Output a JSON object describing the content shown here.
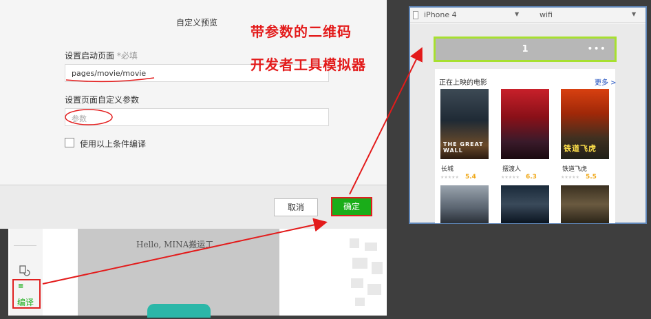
{
  "dialog": {
    "title": "自定义预览",
    "start_page_label": "设置启动页面",
    "start_page_required": "*必填",
    "start_page_value": "pages/movie/movie",
    "params_label": "设置页面自定义参数",
    "params_placeholder": "参数",
    "compile_checkbox_label": "使用以上条件编译",
    "cancel_label": "取消",
    "confirm_label": "确定"
  },
  "annotations": {
    "line1": "带参数的二维码",
    "line2": "开发者工具模拟器"
  },
  "ide": {
    "compile_label": "编译",
    "compile_icon": "≡",
    "hello_text": "Hello, MINA搬运工"
  },
  "simulator": {
    "device": "iPhone 4",
    "network": "wifi",
    "nav_title": "1",
    "nav_menu": "•••",
    "section_title": "正在上映的电影",
    "more_label": "更多 >",
    "movies": [
      {
        "title": "长城",
        "score": "5.4",
        "caption": "THE GREAT WALL"
      },
      {
        "title": "摆渡人",
        "score": "6.3",
        "caption": ""
      },
      {
        "title": "铁道飞虎",
        "score": "5.5",
        "caption": "铁道飞虎"
      }
    ],
    "stars": "★★★★★"
  },
  "colors": {
    "accent_green": "#1aad19",
    "annotation_red": "#e31b1b",
    "nav_border": "#a7e030",
    "sim_border": "#5f86b8"
  }
}
